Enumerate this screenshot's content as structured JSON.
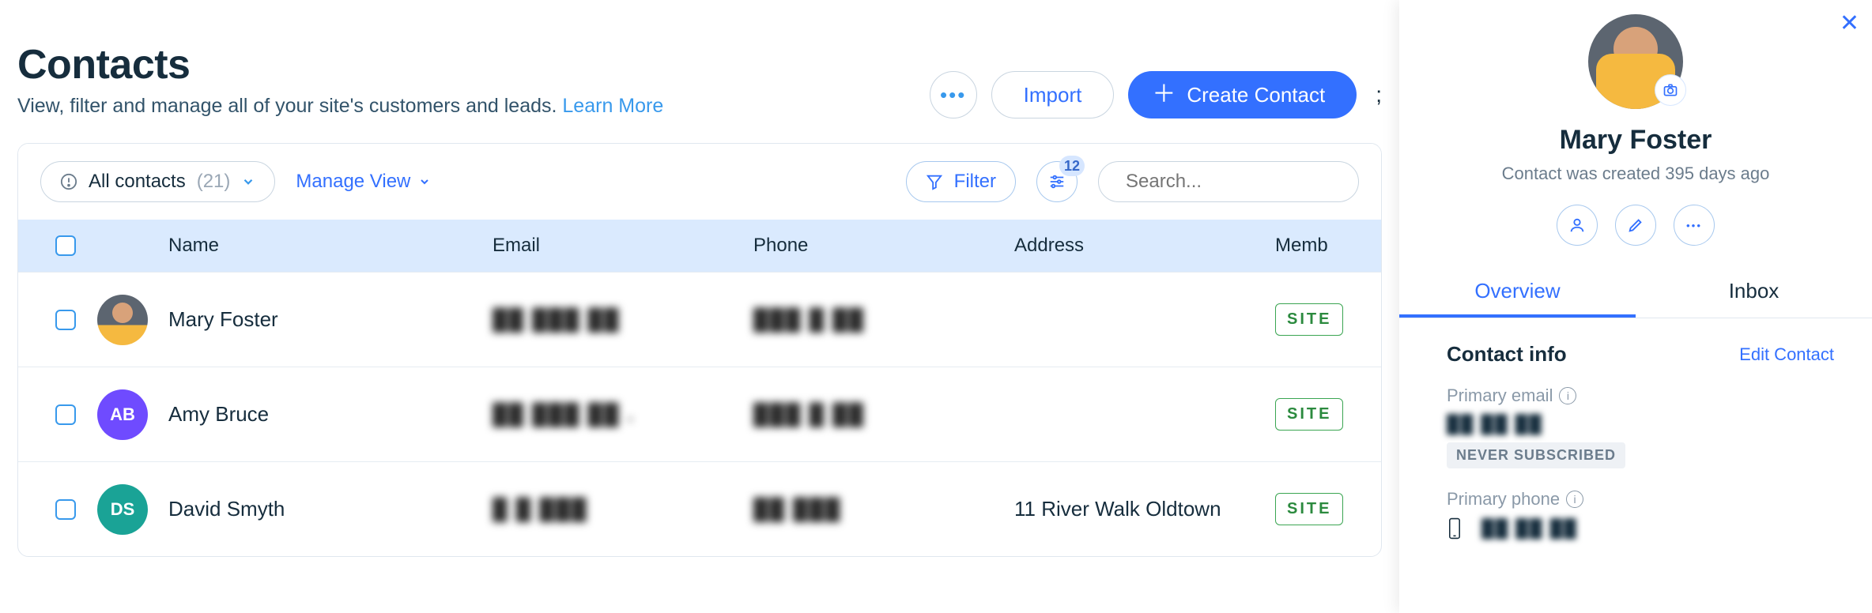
{
  "header": {
    "title": "Contacts",
    "subtitle_prefix": "View, filter and manage all of your site's customers and leads. ",
    "learn_more": "Learn More",
    "more_button_aria": "more-actions",
    "import_label": "Import",
    "create_label": "Create Contact",
    "trailing_char": ";"
  },
  "toolbar": {
    "view_chip": {
      "icon": "alert-circle-icon",
      "label": "All contacts",
      "count_display": "(21)"
    },
    "manage_view": "Manage View",
    "filter_label": "Filter",
    "sliders_badge": "12",
    "search_placeholder": "Search..."
  },
  "table": {
    "columns": {
      "name": "Name",
      "email": "Email",
      "phone": "Phone",
      "address": "Address",
      "member": "Memb"
    },
    "rows": [
      {
        "avatar_type": "image",
        "avatar_bg": "",
        "initials": "",
        "name": "Mary Foster",
        "email": "██ ███ ██",
        "phone": "███ █ ██",
        "address": "",
        "tag": "SITE"
      },
      {
        "avatar_type": "initials",
        "avatar_bg": "#6f4bff",
        "initials": "AB",
        "name": "Amy Bruce",
        "email": "██ ███ ██ .",
        "phone": "███ █ ██",
        "address": "",
        "tag": "SITE"
      },
      {
        "avatar_type": "initials",
        "avatar_bg": "#1aa396",
        "initials": "DS",
        "name": "David Smyth",
        "email": "█ █ ███",
        "phone": "██ ███",
        "address": "11 River Walk Oldtown",
        "tag": "SITE"
      }
    ]
  },
  "panel": {
    "close_aria": "close",
    "name": "Mary Foster",
    "subtitle": "Contact was created 395 days ago",
    "tabs": {
      "overview": "Overview",
      "inbox": "Inbox"
    },
    "section_title": "Contact info",
    "edit_label": "Edit Contact",
    "primary_email_label": "Primary email",
    "primary_email_value": "██ ██ ██",
    "never_subscribed": "NEVER SUBSCRIBED",
    "primary_phone_label": "Primary phone",
    "primary_phone_value": "██ ██ ██"
  }
}
